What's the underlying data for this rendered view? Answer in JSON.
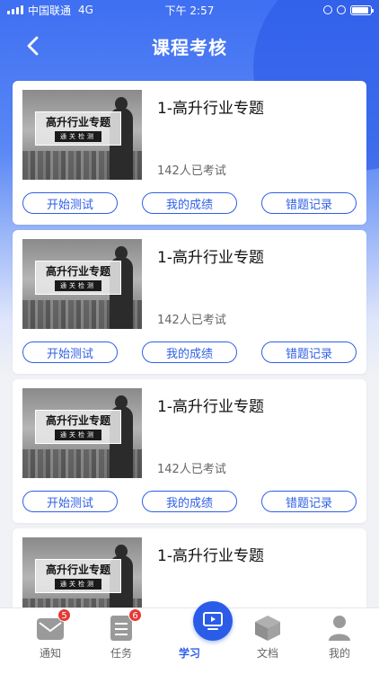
{
  "status_bar": {
    "carrier": "中国联通",
    "network": "4G",
    "time": "下午 2:57"
  },
  "nav": {
    "title": "课程考核",
    "back_icon": "chevron-left-icon"
  },
  "courses": [
    {
      "title": "1-高升行业专题",
      "taken": "142人已考试",
      "thumb_title": "高升行业专题",
      "thumb_sub": "通关检测",
      "buttons": [
        "开始测试",
        "我的成绩",
        "错题记录"
      ]
    },
    {
      "title": "1-高升行业专题",
      "taken": "142人已考试",
      "thumb_title": "高升行业专题",
      "thumb_sub": "通关检测",
      "buttons": [
        "开始测试",
        "我的成绩",
        "错题记录"
      ]
    },
    {
      "title": "1-高升行业专题",
      "taken": "142人已考试",
      "thumb_title": "高升行业专题",
      "thumb_sub": "通关检测",
      "buttons": [
        "开始测试",
        "我的成绩",
        "错题记录"
      ]
    },
    {
      "title": "1-高升行业专题",
      "taken": "",
      "thumb_title": "高升行业专题",
      "thumb_sub": "通关检测",
      "buttons": []
    }
  ],
  "tabs": [
    {
      "label": "通知",
      "icon": "envelope-icon",
      "badge": "5",
      "active": false
    },
    {
      "label": "任务",
      "icon": "list-icon",
      "badge": "6",
      "active": false
    },
    {
      "label": "学习",
      "icon": "play-screen-icon",
      "badge": "",
      "active": true
    },
    {
      "label": "文档",
      "icon": "box-icon",
      "badge": "",
      "active": false
    },
    {
      "label": "我的",
      "icon": "user-icon",
      "badge": "",
      "active": false
    }
  ],
  "colors": {
    "primary": "#2f5fe6",
    "header_blue": "#3f6ff2",
    "badge_red": "#e53935"
  }
}
